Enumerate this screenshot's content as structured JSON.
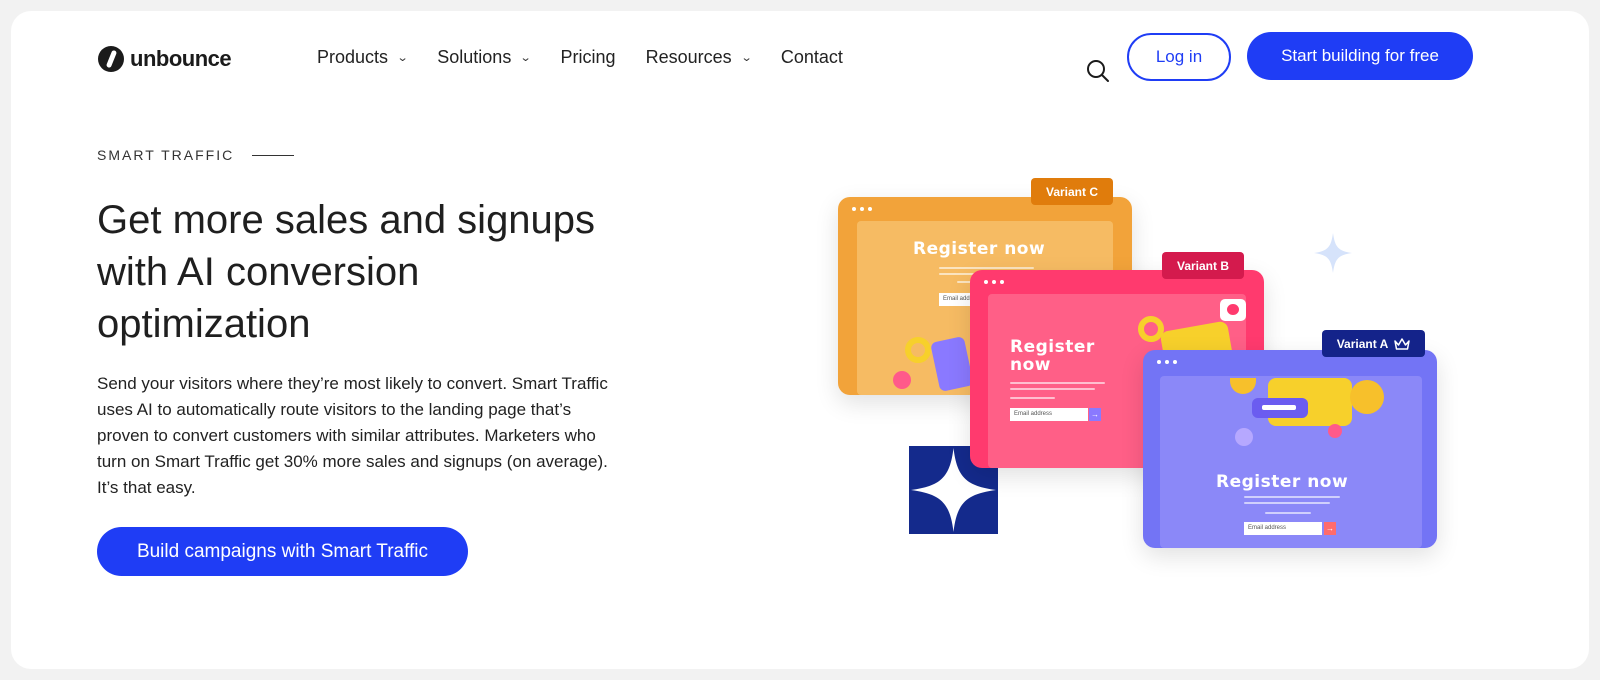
{
  "brand": {
    "name": "unbounce",
    "accent": "#1f3df5"
  },
  "nav": {
    "items": [
      {
        "label": "Products",
        "dropdown": true
      },
      {
        "label": "Solutions",
        "dropdown": true
      },
      {
        "label": "Pricing",
        "dropdown": false
      },
      {
        "label": "Resources",
        "dropdown": true
      },
      {
        "label": "Contact",
        "dropdown": false
      }
    ],
    "search_icon": "search-icon",
    "login_label": "Log in",
    "start_label": "Start building for free"
  },
  "hero": {
    "eyebrow": "SMART TRAFFIC",
    "headline_lines": [
      "Get more sales and signups",
      "with AI conversion",
      "optimization"
    ],
    "body_lines": [
      "Send your visitors where they’re most likely to convert. Smart Traffic",
      "uses AI to automatically route visitors to the landing page that’s",
      "proven to convert customers with similar attributes. Marketers who",
      "turn on Smart Traffic get 30% more sales and signups (on average).",
      "It’s that easy."
    ],
    "cta_label": "Build campaigns with Smart Traffic"
  },
  "illustration": {
    "variants": [
      {
        "tag": "Variant C",
        "heading": "Register now",
        "email_placeholder": "Email address",
        "color": "#f2a33a"
      },
      {
        "tag": "Variant B",
        "heading_lines": [
          "Register",
          "now"
        ],
        "email_placeholder": "Email address",
        "color": "#ff3a6e"
      },
      {
        "tag": "Variant A",
        "heading": "Register now",
        "email_placeholder": "Email address",
        "color": "#7374f5",
        "badge_icon": "crown-icon"
      }
    ]
  }
}
